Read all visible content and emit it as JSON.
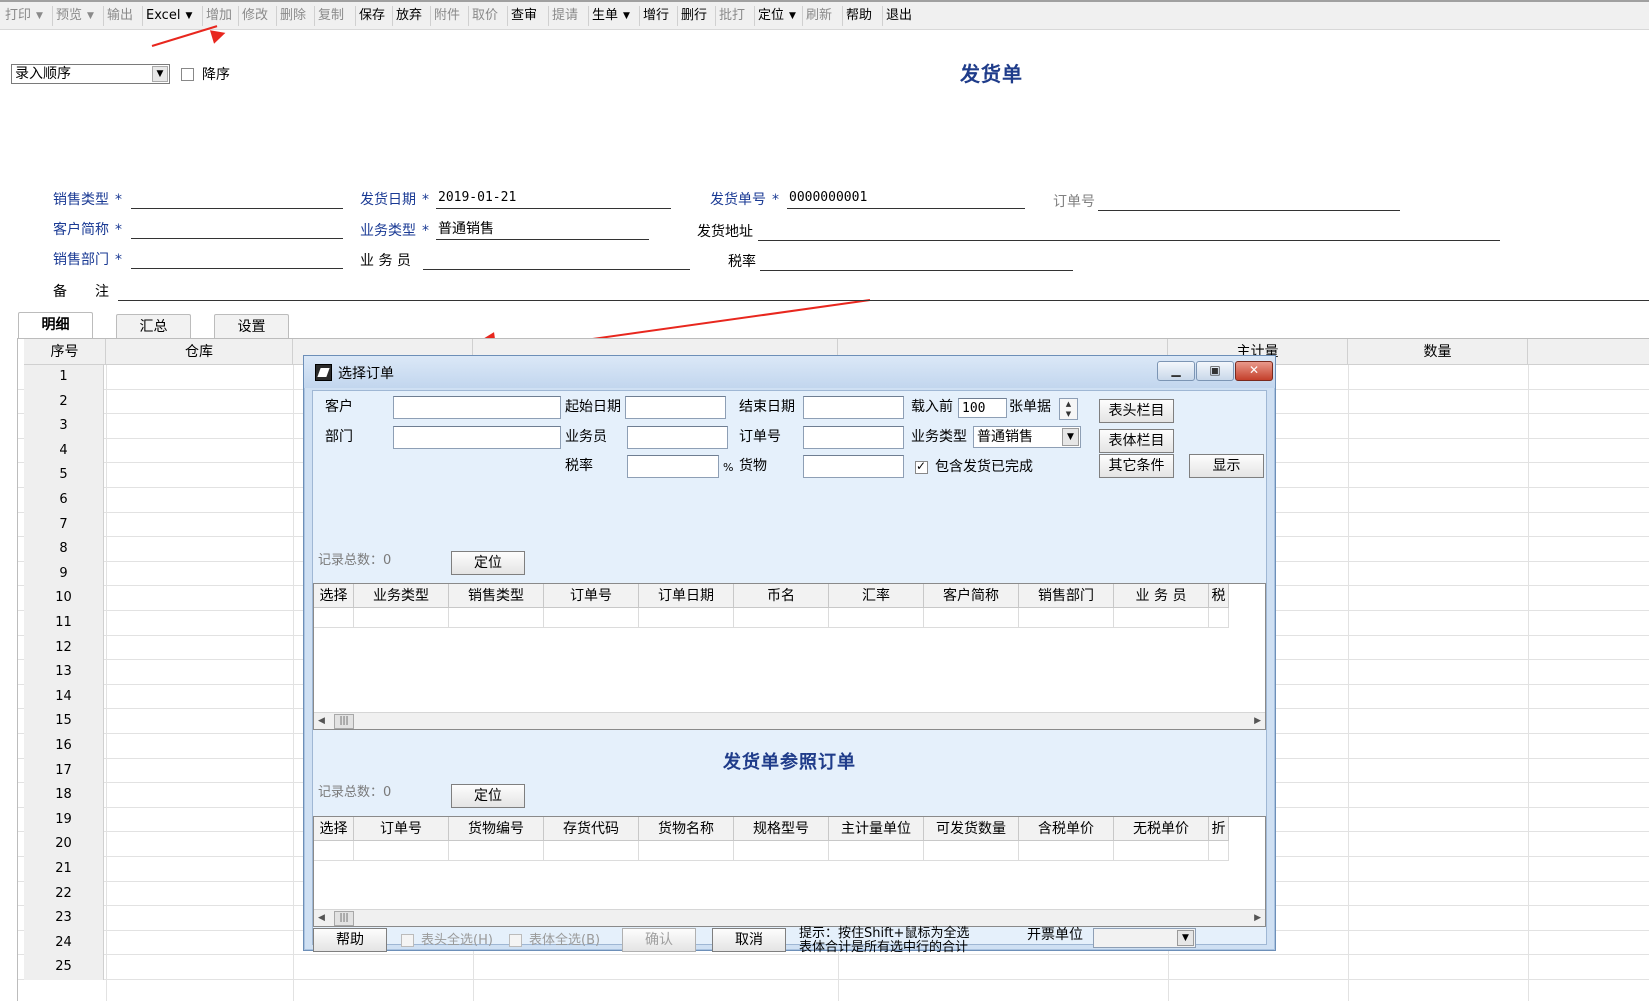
{
  "toolbar": {
    "items": [
      {
        "label": "打印",
        "enabled": false,
        "dropdown": true
      },
      {
        "label": "预览",
        "enabled": false,
        "dropdown": true
      },
      {
        "label": "输出",
        "enabled": false,
        "dropdown": false
      },
      {
        "label": "Excel",
        "enabled": true,
        "dropdown": true
      },
      {
        "label": "增加",
        "enabled": false,
        "dropdown": false
      },
      {
        "label": "修改",
        "enabled": false,
        "dropdown": false
      },
      {
        "label": "删除",
        "enabled": false,
        "dropdown": false
      },
      {
        "label": "复制",
        "enabled": false,
        "dropdown": false
      },
      {
        "label": "保存",
        "enabled": true,
        "dropdown": false
      },
      {
        "label": "放弃",
        "enabled": true,
        "dropdown": false
      },
      {
        "label": "附件",
        "enabled": false,
        "dropdown": false
      },
      {
        "label": "取价",
        "enabled": false,
        "dropdown": false
      },
      {
        "label": "查审",
        "enabled": true,
        "dropdown": false
      },
      {
        "label": "提请",
        "enabled": false,
        "dropdown": false
      },
      {
        "label": "生单",
        "enabled": true,
        "dropdown": true
      },
      {
        "label": "增行",
        "enabled": true,
        "dropdown": false
      },
      {
        "label": "删行",
        "enabled": true,
        "dropdown": false
      },
      {
        "label": "批打",
        "enabled": false,
        "dropdown": false
      },
      {
        "label": "定位",
        "enabled": true,
        "dropdown": true
      },
      {
        "label": "刷新",
        "enabled": false,
        "dropdown": false
      },
      {
        "label": "帮助",
        "enabled": true,
        "dropdown": false
      },
      {
        "label": "退出",
        "enabled": true,
        "dropdown": false
      }
    ]
  },
  "sort": {
    "selected": "录入顺序",
    "descending_label": "降序",
    "descending_checked": false
  },
  "page_title": "发货单",
  "form": {
    "sales_type_label": "销售类型",
    "sales_type_value": "",
    "ship_date_label": "发货日期",
    "ship_date_value": "2019-01-21",
    "ship_no_label": "发货单号",
    "ship_no_value": "0000000001",
    "order_no_label": "订单号",
    "order_no_value": "",
    "customer_label": "客户简称",
    "customer_value": "",
    "biz_type_label": "业务类型",
    "biz_type_value": "普通销售",
    "ship_addr_label": "发货地址",
    "ship_addr_value": "",
    "dept_label": "销售部门",
    "dept_value": "",
    "salesman_label": "业 务 员",
    "salesman_value": "",
    "tax_label": "税率",
    "tax_value": "",
    "remark_label": "备　　注",
    "remark_value": "",
    "required_mark": "*"
  },
  "tabs": [
    "明细",
    "汇总",
    "设置"
  ],
  "grid": {
    "columns": [
      "序号",
      "仓库",
      "主计量",
      "数量"
    ],
    "rows": [
      "1",
      "2",
      "3",
      "4",
      "5",
      "6",
      "7",
      "8",
      "9",
      "10",
      "11",
      "12",
      "13",
      "14",
      "15",
      "16",
      "17",
      "18",
      "19",
      "20",
      "21",
      "22",
      "23",
      "24",
      "25"
    ]
  },
  "dialog": {
    "title": "选择订单",
    "window_buttons": {
      "minimize": "▁",
      "maximize": "▣",
      "close": "✕"
    },
    "filters": {
      "customer_label": "客户",
      "customer_value": "",
      "dept_label": "部门",
      "dept_value": "",
      "start_date_label": "起始日期",
      "start_date_value": "",
      "end_date_label": "结束日期",
      "end_date_value": "",
      "load_before_label": "载入前",
      "load_before_value": "100",
      "load_unit": "张单据",
      "salesman_label": "业务员",
      "salesman_value": "",
      "order_no_label": "订单号",
      "order_no_value": "",
      "biz_type_label": "业务类型",
      "biz_type_value": "普通销售",
      "tax_label": "税率",
      "tax_value": "",
      "tax_unit": "%",
      "goods_label": "货物",
      "goods_value": "",
      "include_done_label": "包含发货已完成",
      "include_done_checked": true
    },
    "buttons": {
      "header_cols": "表头栏目",
      "body_cols": "表体栏目",
      "other_cond": "其它条件",
      "show": "显示",
      "locate": "定位",
      "help": "帮助",
      "confirm": "确认",
      "cancel": "取消"
    },
    "upper": {
      "record_label": "记录总数：0",
      "columns": [
        "选择",
        "业务类型",
        "销售类型",
        "订单号",
        "订单日期",
        "币名",
        "汇率",
        "客户简称",
        "销售部门",
        "业 务 员",
        "税"
      ]
    },
    "sub_title": "发货单参照订单",
    "lower": {
      "record_label": "记录总数：0",
      "columns": [
        "选择",
        "订单号",
        "货物编号",
        "存货代码",
        "货物名称",
        "规格型号",
        "主计量单位",
        "可发货数量",
        "含税单价",
        "无税单价",
        "折"
      ]
    },
    "footer": {
      "select_all_header": "表头全选(H)",
      "select_all_body": "表体全选(B)",
      "hint_line1": "提示：按住Shift+鼠标为全选",
      "hint_line2": "表体合计是所有选中行的合计",
      "invoice_unit_label": "开票单位",
      "invoice_unit_value": ""
    }
  },
  "colors": {
    "title_blue": "#1f3c8a",
    "label_blue": "#1a3a94",
    "arrow_red": "#e8271e",
    "dialog_bg": "#cfe0f3"
  }
}
